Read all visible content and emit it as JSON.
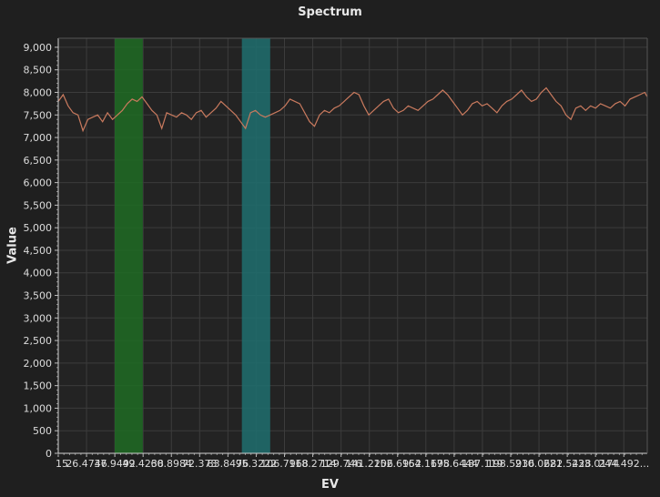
{
  "chart_data": {
    "type": "line",
    "title": "Spectrum",
    "xlabel": "EV",
    "ylabel": "Value",
    "xlim": [
      15,
      254
    ],
    "ylim": [
      0,
      9200
    ],
    "grid": true,
    "y_ticks": [
      0,
      500,
      1000,
      1500,
      2000,
      2500,
      3000,
      3500,
      4000,
      4500,
      5000,
      5500,
      6000,
      6500,
      7000,
      7500,
      8000,
      8500,
      9000
    ],
    "y_tick_labels": [
      "0",
      "500",
      "1,000",
      "1,500",
      "2,000",
      "2,500",
      "3,000",
      "3,500",
      "4,000",
      "4,500",
      "5,000",
      "5,500",
      "6,000",
      "6,500",
      "7,000",
      "7,500",
      "8,000",
      "8,500",
      "9,000"
    ],
    "x_ticks": [
      15,
      26.4746,
      37.9492,
      49.4238,
      60.8984,
      72.373,
      83.8476,
      95.3222,
      106.7968,
      118.2714,
      129.746,
      141.2206,
      152.6952,
      164.1698,
      175.6444,
      187.119,
      198.5936,
      210.0682,
      221.5428,
      233.0174,
      244.492
    ],
    "x_tick_labels": [
      "15",
      "26.4746",
      "37.9492",
      "49.4238",
      "60.8984",
      "72.373",
      "83.8476",
      "95.3222",
      "106.7968",
      "118.2714",
      "129.746",
      "141.2206",
      "152.6952",
      "164.1698",
      "175.6444",
      "187.119",
      "198.5936",
      "210.0682",
      "221.5428",
      "233.0174",
      "244.492..."
    ],
    "regions": [
      {
        "x_start": 37.9,
        "x_end": 49.3,
        "color": "#1f6b23"
      },
      {
        "x_start": 89.5,
        "x_end": 101.0,
        "color": "#1f6e6e"
      }
    ],
    "series": [
      {
        "color": "#c97a5e",
        "x": [
          15,
          17,
          19,
          21,
          23,
          25,
          27,
          29,
          31,
          33,
          35,
          37,
          39,
          41,
          43,
          45,
          47,
          49,
          51,
          53,
          55,
          57,
          59,
          61,
          63,
          65,
          67,
          69,
          71,
          73,
          75,
          77,
          79,
          81,
          83,
          85,
          87,
          89,
          91,
          93,
          95,
          97,
          99,
          101,
          103,
          105,
          107,
          109,
          111,
          113,
          115,
          117,
          119,
          121,
          123,
          125,
          127,
          129,
          131,
          133,
          135,
          137,
          139,
          141,
          143,
          145,
          147,
          149,
          151,
          153,
          155,
          157,
          159,
          161,
          163,
          165,
          167,
          169,
          171,
          173,
          175,
          177,
          179,
          181,
          183,
          185,
          187,
          189,
          191,
          193,
          195,
          197,
          199,
          201,
          203,
          205,
          207,
          209,
          211,
          213,
          215,
          217,
          219,
          221,
          223,
          225,
          227,
          229,
          231,
          233,
          235,
          237,
          239,
          241,
          243,
          245,
          247,
          249,
          251,
          253,
          254
        ],
        "y": [
          7800,
          7950,
          7700,
          7550,
          7500,
          7150,
          7400,
          7450,
          7500,
          7350,
          7550,
          7400,
          7500,
          7600,
          7750,
          7850,
          7800,
          7900,
          7750,
          7600,
          7500,
          7200,
          7550,
          7500,
          7450,
          7550,
          7500,
          7400,
          7550,
          7600,
          7450,
          7550,
          7650,
          7800,
          7700,
          7600,
          7500,
          7350,
          7200,
          7550,
          7600,
          7500,
          7450,
          7500,
          7550,
          7600,
          7700,
          7850,
          7800,
          7750,
          7550,
          7350,
          7250,
          7500,
          7600,
          7550,
          7650,
          7700,
          7800,
          7900,
          8000,
          7950,
          7700,
          7500,
          7600,
          7700,
          7800,
          7850,
          7650,
          7550,
          7600,
          7700,
          7650,
          7600,
          7700,
          7800,
          7850,
          7950,
          8050,
          7950,
          7800,
          7650,
          7500,
          7600,
          7750,
          7800,
          7700,
          7750,
          7650,
          7550,
          7700,
          7800,
          7850,
          7950,
          8050,
          7900,
          7800,
          7850,
          8000,
          8100,
          7950,
          7800,
          7700,
          7500,
          7400,
          7650,
          7700,
          7600,
          7700,
          7650,
          7750,
          7700,
          7650,
          7750,
          7800,
          7700,
          7850,
          7900,
          7950,
          8000,
          7900
        ]
      }
    ]
  }
}
